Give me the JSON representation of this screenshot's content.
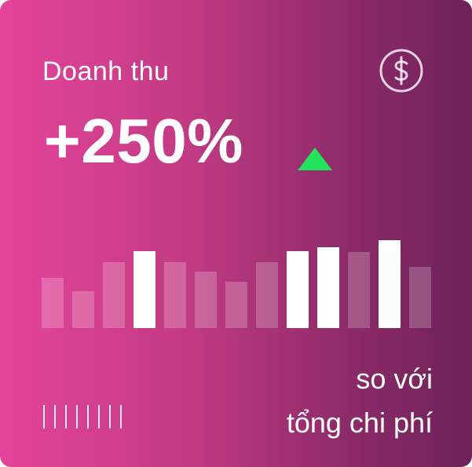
{
  "card": {
    "title": "Doanh thu",
    "value": "+250%",
    "trend_icon": "triangle-up-icon",
    "trend_color": "#22e35a",
    "currency_icon": "dollar-circle-icon",
    "compare_line1": "so với",
    "compare_line2": "tổng chi phí",
    "gradient_start": "#e4449b",
    "gradient_end": "#6e2259"
  },
  "bars": [
    {
      "value": 0.54,
      "opacity": 0.22
    },
    {
      "value": 0.4,
      "opacity": 0.22
    },
    {
      "value": 0.71,
      "opacity": 0.22
    },
    {
      "value": 0.83,
      "opacity": 1.0
    },
    {
      "value": 0.71,
      "opacity": 0.22
    },
    {
      "value": 0.61,
      "opacity": 0.22
    },
    {
      "value": 0.5,
      "opacity": 0.22
    },
    {
      "value": 0.71,
      "opacity": 0.22
    },
    {
      "value": 0.83,
      "opacity": 1.0
    },
    {
      "value": 0.87,
      "opacity": 1.0
    },
    {
      "value": 0.82,
      "opacity": 0.22
    },
    {
      "value": 0.95,
      "opacity": 1.0
    },
    {
      "value": 0.66,
      "opacity": 0.22
    }
  ],
  "tick_count": 8
}
